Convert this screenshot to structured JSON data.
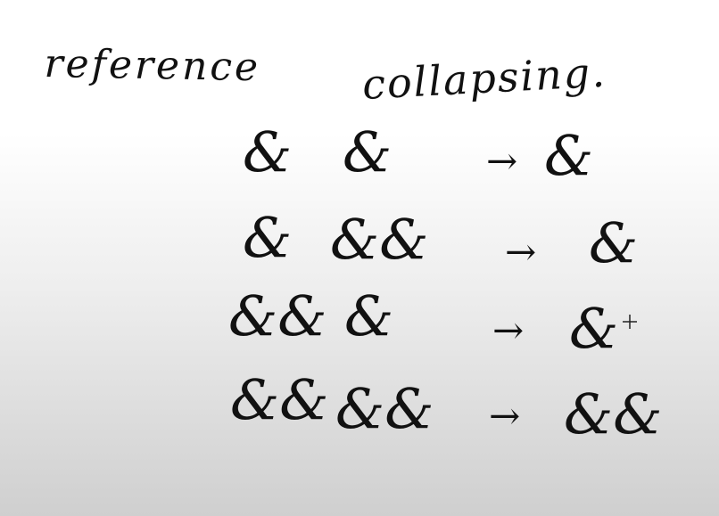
{
  "title": {
    "word1": "reference",
    "word2": "collapsing."
  },
  "rows": [
    {
      "left": "&",
      "right": "&",
      "arrow": "→",
      "result": "&"
    },
    {
      "left": "&",
      "right": "&&",
      "arrow": "→",
      "result": "&"
    },
    {
      "left": "&&",
      "right": "&",
      "arrow": "→",
      "result": "&"
    },
    {
      "left": "&&",
      "right": "&&",
      "arrow": "→",
      "result": "&&"
    }
  ],
  "cursor_icon": "crosshair-icon"
}
